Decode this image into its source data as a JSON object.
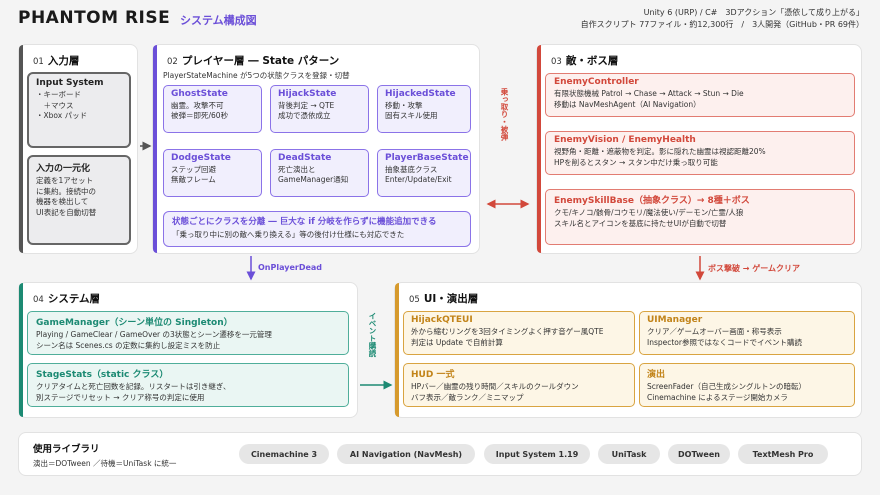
{
  "header": {
    "logo": "PHANTOM RISE",
    "subtitle": "システム構成図",
    "meta_line1": "Unity 6 (URP) / C#　3Dアクション「憑依して成り上がる」",
    "meta_line2": "自作スクリプト 77ファイル・約12,300行　/　3人開発（GitHub・PR 69件）"
  },
  "input_layer": {
    "num": "01",
    "title": "入力層",
    "box1_title": "Input System",
    "box1_desc": "・キーボード\n　＋マウス\n・Xbox パッド",
    "box2_title": "入力の一元化",
    "box2_desc": "定義を1アセット\nに集約。接続中の\n機器を検出して\nUI表記を自動切替"
  },
  "player_layer": {
    "num": "02",
    "title": "プレイヤー層 ― State パターン",
    "subtitle": "PlayerStateMachine が5つの状態クラスを登録・切替",
    "states": [
      {
        "title": "GhostState",
        "desc": "幽霊。攻撃不可\n被弾＝即死/60秒"
      },
      {
        "title": "HijackState",
        "desc": "背後判定 → QTE\n成功で憑依成立"
      },
      {
        "title": "HijackedState",
        "desc": "移動・攻撃\n固有スキル使用"
      },
      {
        "title": "DodgeState",
        "desc": "ステップ回避\n無敵フレーム"
      },
      {
        "title": "DeadState",
        "desc": "死亡演出と\nGameManager通知"
      },
      {
        "title": "PlayerBaseState",
        "desc": "抽象基底クラス\nEnter/Update/Exit"
      }
    ],
    "note_title": "状態ごとにクラスを分離 ― 巨大な if 分岐を作らずに機能追加できる",
    "note_desc": "「乗っ取り中に別の敵へ乗り換える」等の後付け仕様にも対応できた"
  },
  "enemy_layer": {
    "num": "03",
    "title": "敵・ボス層",
    "boxes": [
      {
        "title": "EnemyController",
        "desc": "有限状態機械 Patrol → Chase → Attack → Stun → Die\n移動は NavMeshAgent（AI Navigation）"
      },
      {
        "title": "EnemyVision / EnemyHealth",
        "desc": "視野角・距離・遮蔽物を判定。影に隠れた幽霊は視認距離20%\nHPを削るとスタン → スタン中だけ乗っ取り可能"
      },
      {
        "title": "EnemySkillBase（抽象クラス）→ 8種＋ボス",
        "desc": "クモ/キノコ/骸骨/コウモリ/魔法使い/デーモン/亡霊/人狼\nスキル名とアイコンを基底に持たせUIが自動で切替"
      }
    ]
  },
  "system_layer": {
    "num": "04",
    "title": "システム層",
    "boxes": [
      {
        "title": "GameManager（シーン単位の Singleton）",
        "desc": "Playing / GameClear / GameOver の3状態とシーン遷移を一元管理\nシーン名は Scenes.cs の定数に集約し設定ミスを防止"
      },
      {
        "title": "StageStats（static クラス）",
        "desc": "クリアタイムと死亡回数を記録。リスタートは引き継ぎ、\n別ステージでリセット → クリア称号の判定に使用"
      }
    ]
  },
  "ui_layer": {
    "num": "05",
    "title": "UI・演出層",
    "boxes": [
      {
        "title": "HijackQTEUI",
        "desc": "外から縮むリングを3回タイミングよく押す音ゲー風QTE\n判定は Update で自前計算"
      },
      {
        "title": "UIManager",
        "desc": "クリア／ゲームオーバー画面・称号表示\nInspector参照ではなくコードでイベント購読"
      },
      {
        "title": "HUD 一式",
        "desc": "HPバー／幽霊の残り時間／スキルのクールダウン\nバフ表示／敵ランク／ミニマップ"
      },
      {
        "title": "演出",
        "desc": "ScreenFader（自己生成シングルトンの暗転）\nCinemachine によるステージ開始カメラ"
      }
    ]
  },
  "arrows": {
    "player_to_system": "OnPlayerDead",
    "player_enemy": "乗っ取り・被弾",
    "enemy_to_ui": "ボス撃破 → ゲームクリア",
    "system_to_ui": "イベント購読"
  },
  "libraries": {
    "title": "使用ライブラリ",
    "note": "演出＝DOTween ／待機＝UniTask に統一",
    "items": [
      "Cinemachine 3",
      "AI Navigation (NavMesh)",
      "Input System 1.19",
      "UniTask",
      "DOTween",
      "TextMesh Pro"
    ]
  },
  "colors": {
    "input": "#555555",
    "player": "#6b4fd8",
    "enemy": "#d2483b",
    "system": "#1c8a73",
    "ui": "#d69a2d"
  }
}
